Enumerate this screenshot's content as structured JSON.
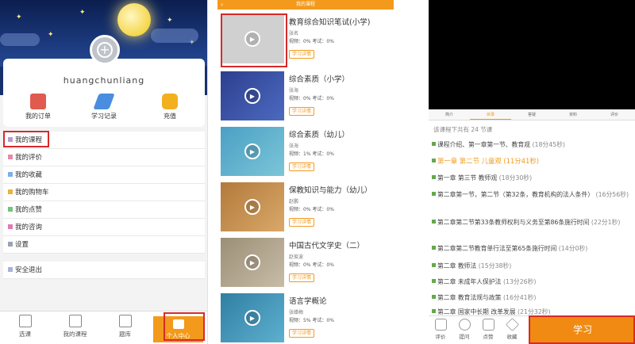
{
  "profile": {
    "username": "huangchunliang",
    "quick_actions": [
      {
        "label": "我的订单",
        "icon": "order-icon",
        "color": "#e05a4f"
      },
      {
        "label": "学习记录",
        "icon": "pen-icon",
        "color": "#4a8de0"
      },
      {
        "label": "充值",
        "icon": "wallet-icon",
        "color": "#f2b01e"
      }
    ],
    "menu": [
      {
        "label": "我的课程",
        "color": "#b89ad6"
      },
      {
        "label": "我的评价",
        "color": "#e58aa8"
      },
      {
        "label": "我的收藏",
        "color": "#7fb0e4"
      },
      {
        "label": "我的购物车",
        "color": "#e8b33d"
      },
      {
        "label": "我的点赞",
        "color": "#75c27a"
      },
      {
        "label": "我的咨询",
        "color": "#e27ab0"
      },
      {
        "label": "设置",
        "color": "#9aa3b4"
      },
      {
        "label": "安全退出",
        "color": "#a7b3d6"
      }
    ],
    "nav": [
      {
        "label": "选课"
      },
      {
        "label": "我的课程"
      },
      {
        "label": "题库"
      },
      {
        "label": "个人中心"
      }
    ]
  },
  "course_list": {
    "header_title": "我的课程",
    "back": "‹",
    "courses": [
      {
        "title": "教育综合知识笔试(小学)",
        "teacher": "张名",
        "stats": "视频：0%      考试：0%",
        "button": "学习详情",
        "thumb": "#d0d0d0"
      },
      {
        "title": "综合素质（小学）",
        "teacher": "张海",
        "stats": "视频：0%      考试：0%",
        "button": "学习详情",
        "thumb": "#3b4fa3"
      },
      {
        "title": "综合素质（幼儿）",
        "teacher": "张海",
        "stats": "视频：1%      考试：0%",
        "button": "学习详情",
        "thumb": "#5aa9c9"
      },
      {
        "title": "保教知识与能力（幼儿）",
        "teacher": "赵鹏",
        "stats": "视频：0%      考试：0%",
        "button": "学习详情",
        "thumb": "#c28a4a"
      },
      {
        "title": "中国古代文学史（二）",
        "teacher": "赵俊波",
        "stats": "视频：0%      考试：0%",
        "button": "学习详情",
        "thumb": "#a99d8a"
      },
      {
        "title": "语言学概论",
        "teacher": "张蜡梅",
        "stats": "视频：5%      考试：0%",
        "button": "学习详情",
        "thumb": "#3f8fb0"
      }
    ]
  },
  "player": {
    "tabs": [
      {
        "label": "简介"
      },
      {
        "label": "目录"
      },
      {
        "label": "答疑"
      },
      {
        "label": "资料"
      },
      {
        "label": "评价"
      }
    ],
    "totals": "该课程下共有 24 节课",
    "chapters": [
      {
        "title": "课程介绍、第一章第一节、教育观",
        "duration": "(18分45秒)"
      },
      {
        "title": "第一章 第二节 儿童观",
        "duration": "(11分41秒)"
      },
      {
        "title": "第一章 第三节 教师观",
        "duration": "(18分30秒)"
      },
      {
        "title": "第二章第一节，第二节（第32条，教育机构的法人条件）",
        "duration": "(16分56秒)"
      },
      {
        "title": "第二章第二节第33条教师权利与义务至第86条施行时间",
        "duration": "(22分1秒)"
      },
      {
        "title": "第二章第二节教育单行法至第65条施行时间",
        "duration": "(14分0秒)"
      },
      {
        "title": "第二章 教师法",
        "duration": "(15分38秒)"
      },
      {
        "title": "第二章 未成年人保护法",
        "duration": "(13分26秒)"
      },
      {
        "title": "第二章 教育法规与政策",
        "duration": "(16分41秒)"
      },
      {
        "title": "第二章 国家中长期 改革发展",
        "duration": "(21分32秒)"
      }
    ],
    "actions": [
      {
        "label": "评价"
      },
      {
        "label": "提问"
      },
      {
        "label": "点赞"
      },
      {
        "label": "收藏"
      }
    ],
    "study_button": "学习"
  },
  "colors": {
    "accent": "#f39a1c",
    "highlight": "#d62a2a"
  }
}
